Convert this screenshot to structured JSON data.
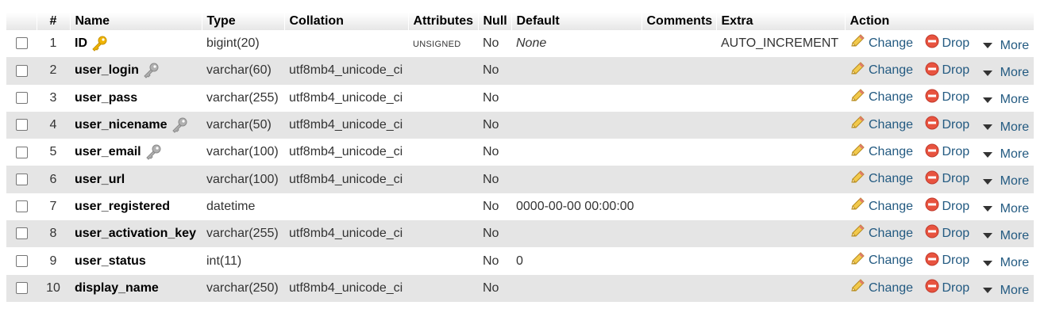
{
  "headers": {
    "num": "#",
    "name": "Name",
    "type": "Type",
    "collation": "Collation",
    "attributes": "Attributes",
    "null": "Null",
    "default": "Default",
    "comments": "Comments",
    "extra": "Extra",
    "action": "Action"
  },
  "actions": {
    "change": "Change",
    "drop": "Drop",
    "more": "More"
  },
  "rows": [
    {
      "num": "1",
      "name": "ID",
      "key": "primary",
      "type": "bigint(20)",
      "collation": "",
      "attributes": "UNSIGNED",
      "null": "No",
      "default": "None",
      "default_italic": true,
      "extra": "AUTO_INCREMENT"
    },
    {
      "num": "2",
      "name": "user_login",
      "key": "index",
      "type": "varchar(60)",
      "collation": "utf8mb4_unicode_ci",
      "attributes": "",
      "null": "No",
      "default": "",
      "extra": ""
    },
    {
      "num": "3",
      "name": "user_pass",
      "key": "",
      "type": "varchar(255)",
      "collation": "utf8mb4_unicode_ci",
      "attributes": "",
      "null": "No",
      "default": "",
      "extra": ""
    },
    {
      "num": "4",
      "name": "user_nicename",
      "key": "index",
      "type": "varchar(50)",
      "collation": "utf8mb4_unicode_ci",
      "attributes": "",
      "null": "No",
      "default": "",
      "extra": ""
    },
    {
      "num": "5",
      "name": "user_email",
      "key": "index",
      "type": "varchar(100)",
      "collation": "utf8mb4_unicode_ci",
      "attributes": "",
      "null": "No",
      "default": "",
      "extra": ""
    },
    {
      "num": "6",
      "name": "user_url",
      "key": "",
      "type": "varchar(100)",
      "collation": "utf8mb4_unicode_ci",
      "attributes": "",
      "null": "No",
      "default": "",
      "extra": ""
    },
    {
      "num": "7",
      "name": "user_registered",
      "key": "",
      "type": "datetime",
      "collation": "",
      "attributes": "",
      "null": "No",
      "default": "0000-00-00 00:00:00",
      "extra": ""
    },
    {
      "num": "8",
      "name": "user_activation_key",
      "key": "",
      "type": "varchar(255)",
      "collation": "utf8mb4_unicode_ci",
      "attributes": "",
      "null": "No",
      "default": "",
      "extra": ""
    },
    {
      "num": "9",
      "name": "user_status",
      "key": "",
      "type": "int(11)",
      "collation": "",
      "attributes": "",
      "null": "No",
      "default": "0",
      "extra": ""
    },
    {
      "num": "10",
      "name": "display_name",
      "key": "",
      "type": "varchar(250)",
      "collation": "utf8mb4_unicode_ci",
      "attributes": "",
      "null": "No",
      "default": "",
      "extra": ""
    }
  ],
  "icons": {
    "primary": "primary-key-icon",
    "index": "index-key-icon",
    "change": "pencil-icon",
    "drop": "drop-icon",
    "more": "caret-down-icon"
  },
  "colors": {
    "link": "#235a81",
    "primary_key": "#f0b400",
    "index_key": "#b0b0b0",
    "drop": "#e8533f",
    "even_row": "#e5e5e5"
  }
}
